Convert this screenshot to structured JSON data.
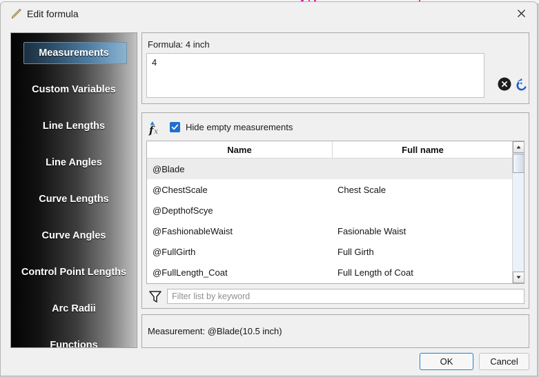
{
  "window": {
    "title": "Edit formula",
    "title_icon": "pencil-icon",
    "close_icon": "close-icon"
  },
  "sidebar": {
    "items": [
      {
        "label": "Measurements",
        "selected": true
      },
      {
        "label": "Custom Variables",
        "selected": false
      },
      {
        "label": "Line Lengths",
        "selected": false
      },
      {
        "label": "Line Angles",
        "selected": false
      },
      {
        "label": "Curve Lengths",
        "selected": false
      },
      {
        "label": "Curve Angles",
        "selected": false
      },
      {
        "label": "Control Point Lengths",
        "selected": false
      },
      {
        "label": "Arc Radii",
        "selected": false
      },
      {
        "label": "Functions",
        "selected": false
      }
    ]
  },
  "formula_panel": {
    "label": "Formula:  4 inch",
    "value": "4",
    "clear_icon": "clear-circle-icon",
    "undo_icon": "undo-arrow-icon"
  },
  "list_panel": {
    "fx_icon": "fx-function-icon",
    "hide_empty_label": "Hide empty measurements",
    "hide_empty_checked": true,
    "columns": [
      "Name",
      "Full name"
    ],
    "rows": [
      {
        "name": "@Blade",
        "full_name": "",
        "selected": true
      },
      {
        "name": "@ChestScale",
        "full_name": "Chest Scale",
        "selected": false
      },
      {
        "name": "@DepthofScye",
        "full_name": "",
        "selected": false
      },
      {
        "name": "@FashionableWaist",
        "full_name": "Fasionable Waist",
        "selected": false
      },
      {
        "name": "@FullGirth",
        "full_name": "Full Girth",
        "selected": false
      },
      {
        "name": "@FullLength_Coat",
        "full_name": "Full Length of Coat",
        "selected": false
      }
    ],
    "filter": {
      "icon": "filter-funnel-icon",
      "placeholder": "Filter list by keyword",
      "value": ""
    },
    "scrollbar": {
      "up_icon": "scroll-up-arrow-icon",
      "down_icon": "scroll-down-arrow-icon"
    }
  },
  "result_panel": {
    "text": "Measurement: @Blade(10.5 inch)"
  },
  "footer": {
    "ok_label": "OK",
    "cancel_label": "Cancel"
  },
  "colors": {
    "accent_blue": "#1f6fd0",
    "selection_blue": "#4d7ba0",
    "dialog_bg": "#f0f0f0",
    "magenta_piece": "#e8299a"
  }
}
